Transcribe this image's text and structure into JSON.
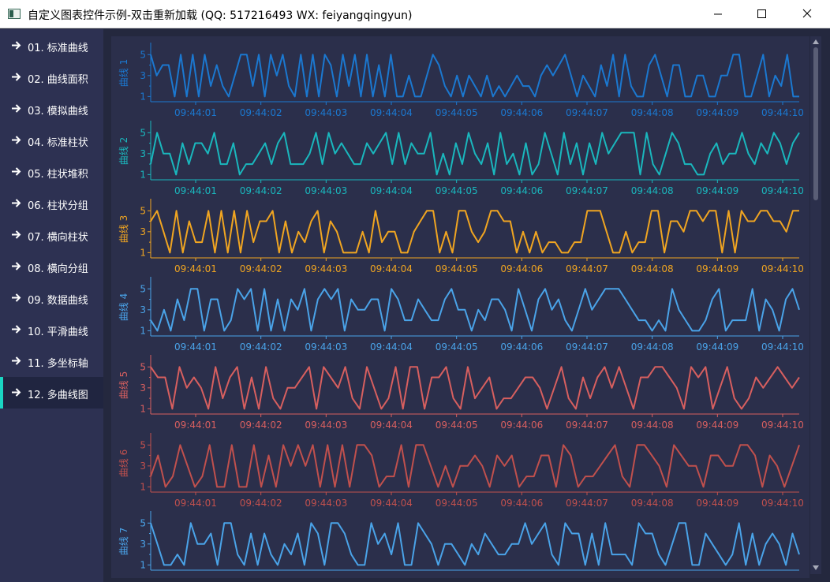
{
  "window": {
    "title": "自定义图表控件示例-双击重新加载 (QQ: 517216493 WX: feiyangqingyun)"
  },
  "sidebar": {
    "items": [
      {
        "label": "01. 标准曲线",
        "active": false
      },
      {
        "label": "02. 曲线面积",
        "active": false
      },
      {
        "label": "03. 模拟曲线",
        "active": false
      },
      {
        "label": "04. 标准柱状",
        "active": false
      },
      {
        "label": "05. 柱状堆积",
        "active": false
      },
      {
        "label": "06. 柱状分组",
        "active": false
      },
      {
        "label": "07. 横向柱状",
        "active": false
      },
      {
        "label": "08. 横向分组",
        "active": false
      },
      {
        "label": "09. 数据曲线",
        "active": false
      },
      {
        "label": "10. 平滑曲线",
        "active": false
      },
      {
        "label": "11. 多坐标轴",
        "active": false
      },
      {
        "label": "12. 多曲线图",
        "active": true
      }
    ],
    "accent_color": "#1ad6c3"
  },
  "chart_data": [
    {
      "type": "line",
      "color": "#1b78d0",
      "ylabel": "曲线 1",
      "yticks": [
        "1",
        "3",
        "5"
      ],
      "ylim": [
        0.5,
        6
      ],
      "xtick_labels": [
        "09:44:01",
        "09:44:02",
        "09:44:03",
        "09:44:04",
        "09:44:05",
        "09:44:06",
        "09:44:07",
        "09:44:08",
        "09:44:09",
        "09:44:10"
      ],
      "values": [
        5,
        3,
        4,
        4,
        1,
        5,
        1,
        5,
        1,
        5,
        2,
        4,
        2,
        1,
        3,
        5,
        5,
        2,
        5,
        1,
        5,
        3,
        5,
        2,
        1,
        5,
        1,
        5,
        1,
        5,
        4,
        1,
        5,
        2,
        5,
        1,
        5,
        1,
        4,
        1,
        5,
        1,
        1,
        3,
        1,
        1,
        3,
        5,
        4,
        2,
        1,
        3,
        1,
        3,
        2,
        1,
        3,
        1,
        2,
        1,
        2,
        3,
        2,
        2,
        1,
        3,
        4,
        3,
        4,
        5,
        3,
        1,
        3,
        2,
        1,
        4,
        2,
        5,
        1,
        5,
        2,
        1,
        1,
        4,
        5,
        3,
        1,
        4,
        4,
        1,
        1,
        3,
        3,
        1,
        1,
        3,
        3,
        5,
        5,
        1,
        1,
        3,
        5,
        1,
        3,
        2,
        5,
        1,
        1
      ]
    },
    {
      "type": "line",
      "color": "#1ab7bd",
      "ylabel": "曲线 2",
      "yticks": [
        "1",
        "3",
        "5"
      ],
      "ylim": [
        0.5,
        6
      ],
      "xtick_labels": [
        "09:44:01",
        "09:44:02",
        "09:44:03",
        "09:44:04",
        "09:44:05",
        "09:44:06",
        "09:44:07",
        "09:44:08",
        "09:44:09",
        "09:44:10"
      ],
      "values": [
        2,
        5,
        3,
        3,
        1,
        4,
        2,
        4,
        4,
        3,
        5,
        2,
        2,
        4,
        1,
        2,
        2,
        3,
        4,
        2,
        4,
        5,
        2,
        2,
        2,
        3,
        5,
        2,
        5,
        3,
        4,
        3,
        2,
        2,
        4,
        3,
        4,
        5,
        2,
        5,
        2,
        4,
        3,
        3,
        5,
        1,
        3,
        1,
        4,
        2,
        5,
        3,
        2,
        4,
        1,
        5,
        2,
        3,
        1,
        4,
        1,
        2,
        5,
        3,
        1,
        5,
        2,
        4,
        1,
        4,
        2,
        5,
        3,
        4,
        5,
        5,
        5,
        1,
        5,
        2,
        1,
        3,
        5,
        4,
        2,
        2,
        1,
        1,
        3,
        4,
        2,
        3,
        3,
        5,
        3,
        2,
        4,
        3,
        5,
        4,
        2,
        4,
        5
      ]
    },
    {
      "type": "line",
      "color": "#f0a521",
      "ylabel": "曲线 3",
      "yticks": [
        "1",
        "3",
        "5"
      ],
      "ylim": [
        0.5,
        6
      ],
      "xtick_labels": [
        "09:44:01",
        "09:44:02",
        "09:44:03",
        "09:44:04",
        "09:44:05",
        "09:44:06",
        "09:44:07",
        "09:44:08",
        "09:44:09",
        "09:44:10"
      ],
      "values": [
        4,
        5,
        3,
        1,
        5,
        1,
        4,
        2,
        2,
        5,
        1,
        5,
        1,
        5,
        1,
        5,
        2,
        4,
        4,
        5,
        1,
        4,
        1,
        3,
        2,
        4,
        5,
        1,
        4,
        3,
        1,
        1,
        1,
        3,
        1,
        5,
        2,
        3,
        3,
        1,
        1,
        3,
        4,
        5,
        5,
        1,
        3,
        1,
        5,
        5,
        3,
        2,
        3,
        5,
        5,
        4,
        4,
        1,
        3,
        1,
        3,
        1,
        2,
        2,
        1,
        1,
        2,
        2,
        5,
        5,
        5,
        3,
        1,
        1,
        3,
        1,
        2,
        2,
        5,
        5,
        1,
        4,
        4,
        3,
        5,
        5,
        4,
        5,
        5,
        1,
        5,
        1,
        5,
        4,
        4,
        5,
        5,
        4,
        4,
        3,
        5,
        5
      ]
    },
    {
      "type": "line",
      "color": "#4aa3e8",
      "ylabel": "曲线 4",
      "yticks": [
        "1",
        "3",
        "5"
      ],
      "ylim": [
        0.5,
        6
      ],
      "xtick_labels": [
        "09:44:01",
        "09:44:02",
        "09:44:03",
        "09:44:04",
        "09:44:05",
        "09:44:06",
        "09:44:07",
        "09:44:08",
        "09:44:09",
        "09:44:10"
      ],
      "values": [
        2,
        1,
        3,
        1,
        4,
        2,
        5,
        5,
        1,
        4,
        4,
        1,
        2,
        5,
        4,
        5,
        1,
        5,
        1,
        4,
        1,
        4,
        3,
        5,
        1,
        4,
        5,
        4,
        5,
        1,
        4,
        3,
        3,
        4,
        4,
        1,
        5,
        4,
        2,
        2,
        4,
        3,
        2,
        2,
        4,
        5,
        3,
        3,
        1,
        3,
        2,
        4,
        4,
        3,
        1,
        5,
        3,
        1,
        4,
        5,
        3,
        4,
        2,
        1,
        3,
        5,
        3,
        4,
        5,
        5,
        5,
        4,
        3,
        2,
        2,
        1,
        2,
        1,
        5,
        3,
        2,
        1,
        1,
        2,
        4,
        5,
        1,
        2,
        2,
        2,
        5,
        1,
        4,
        3,
        1,
        4,
        5,
        3
      ]
    },
    {
      "type": "line",
      "color": "#d75f5f",
      "ylabel": "曲线 5",
      "yticks": [
        "1",
        "3",
        "5"
      ],
      "ylim": [
        0.5,
        6
      ],
      "xtick_labels": [
        "09:44:01",
        "09:44:02",
        "09:44:03",
        "09:44:04",
        "09:44:05",
        "09:44:06",
        "09:44:07",
        "09:44:08",
        "09:44:09",
        "09:44:10"
      ],
      "values": [
        5,
        4,
        4,
        1,
        5,
        3,
        4,
        3,
        1,
        5,
        2,
        4,
        5,
        1,
        4,
        1,
        5,
        2,
        1,
        3,
        3,
        4,
        5,
        1,
        5,
        4,
        3,
        5,
        2,
        1,
        5,
        3,
        1,
        2,
        5,
        1,
        5,
        5,
        1,
        4,
        4,
        5,
        2,
        1,
        5,
        2,
        3,
        4,
        1,
        2,
        2,
        3,
        4,
        4,
        3,
        1,
        3,
        5,
        2,
        1,
        4,
        2,
        4,
        5,
        3,
        5,
        3,
        1,
        4,
        4,
        5,
        5,
        4,
        3,
        1,
        5,
        4,
        5,
        1,
        3,
        5,
        2,
        1,
        2,
        4,
        3,
        4,
        5,
        4,
        3,
        4
      ]
    },
    {
      "type": "line",
      "color": "#c0504d",
      "ylabel": "曲线 6",
      "yticks": [
        "1",
        "3",
        "5"
      ],
      "ylim": [
        0.5,
        6
      ],
      "xtick_labels": [
        "09:44:01",
        "09:44:02",
        "09:44:03",
        "09:44:04",
        "09:44:05",
        "09:44:06",
        "09:44:07",
        "09:44:08",
        "09:44:09",
        "09:44:10"
      ],
      "values": [
        2,
        4,
        1,
        2,
        5,
        3,
        1,
        2,
        5,
        1,
        1,
        5,
        1,
        1,
        5,
        1,
        4,
        1,
        5,
        3,
        5,
        3,
        5,
        1,
        5,
        1,
        5,
        1,
        5,
        5,
        4,
        1,
        2,
        2,
        5,
        1,
        5,
        5,
        3,
        1,
        3,
        1,
        3,
        3,
        4,
        3,
        1,
        4,
        3,
        4,
        1,
        2,
        2,
        4,
        4,
        1,
        5,
        4,
        1,
        2,
        2,
        3,
        4,
        5,
        2,
        1,
        5,
        5,
        4,
        3,
        1,
        5,
        4,
        3,
        3,
        1,
        4,
        4,
        3,
        3,
        5,
        5,
        4,
        1,
        4,
        3,
        1,
        3,
        5
      ]
    },
    {
      "type": "line",
      "color": "#4aa3e8",
      "ylabel": "曲线 7",
      "yticks": [
        "1",
        "3",
        "5"
      ],
      "ylim": [
        0.5,
        6
      ],
      "xtick_labels": [],
      "values": [
        5,
        3,
        1,
        1,
        2,
        1,
        5,
        3,
        3,
        4,
        1,
        5,
        5,
        2,
        1,
        4,
        1,
        4,
        2,
        1,
        3,
        2,
        4,
        1,
        5,
        4,
        1,
        5,
        5,
        4,
        2,
        1,
        1,
        5,
        3,
        4,
        2,
        5,
        1,
        1,
        5,
        4,
        3,
        1,
        3,
        3,
        2,
        1,
        3,
        2,
        4,
        3,
        2,
        2,
        3,
        3,
        5,
        3,
        4,
        5,
        2,
        1,
        5,
        4,
        4,
        1,
        4,
        1,
        5,
        2,
        2,
        2,
        1,
        5,
        4,
        4,
        2,
        1,
        3,
        5,
        5,
        1,
        1,
        4,
        3,
        2,
        1,
        2,
        5,
        1,
        4,
        1,
        3,
        4,
        3,
        1,
        4,
        2
      ]
    }
  ]
}
